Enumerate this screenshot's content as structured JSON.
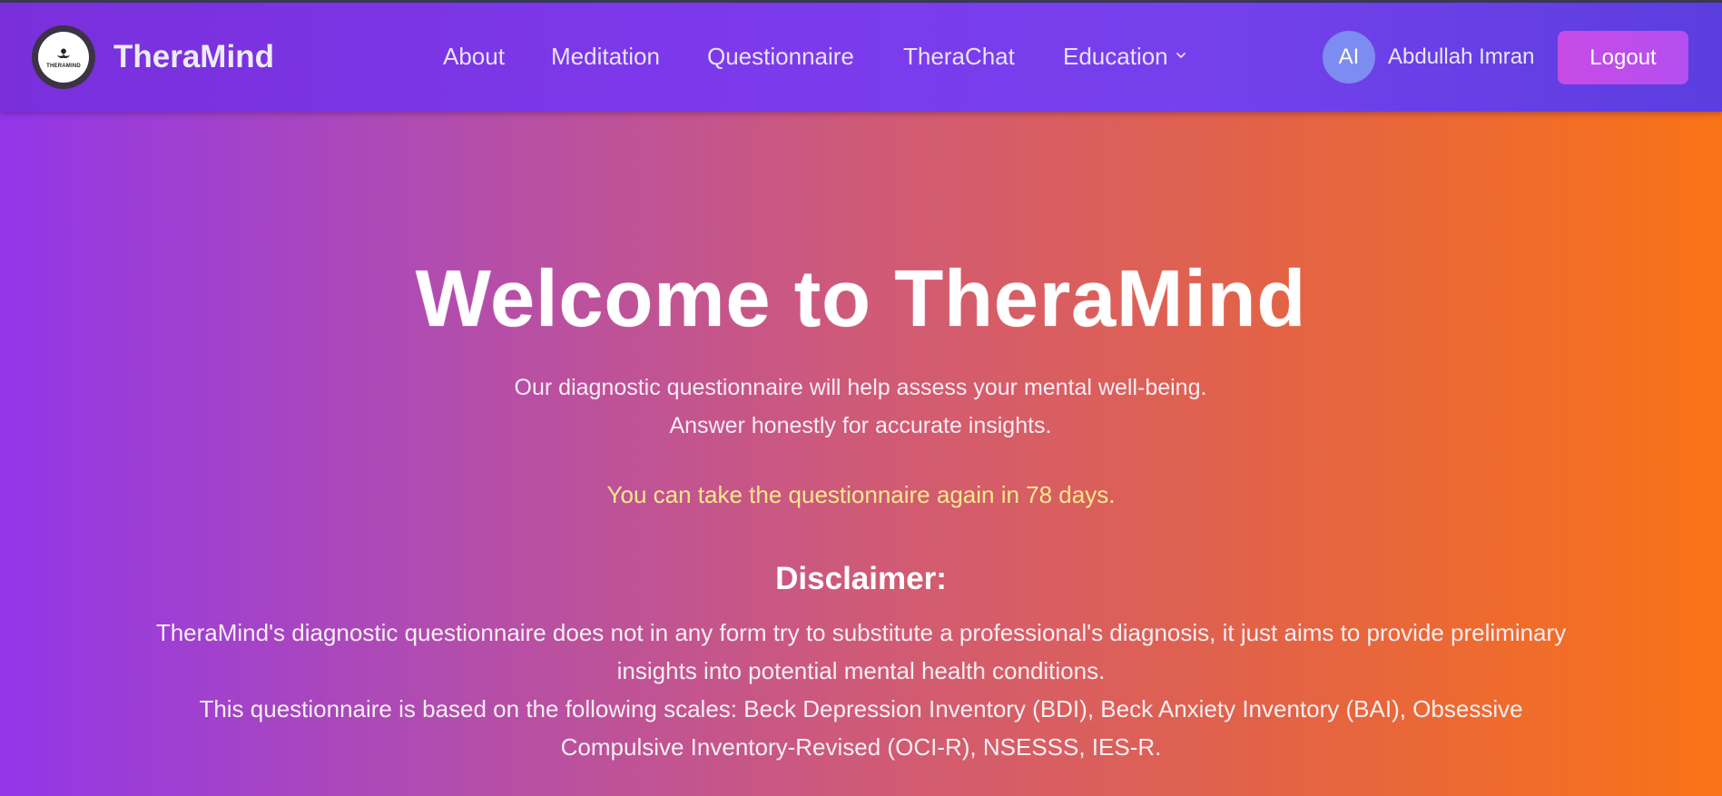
{
  "app": {
    "brand_name": "TheraMind",
    "logo_text": "THERAMIND"
  },
  "nav": {
    "items": [
      {
        "label": "About"
      },
      {
        "label": "Meditation"
      },
      {
        "label": "Questionnaire"
      },
      {
        "label": "TheraChat"
      },
      {
        "label": "Education"
      }
    ]
  },
  "user": {
    "initials": "AI",
    "name": "Abdullah Imran",
    "logout_label": "Logout"
  },
  "hero": {
    "title": "Welcome to TheraMind",
    "intro": "Our diagnostic questionnaire will help assess your mental well-being. Answer honestly for accurate insights.",
    "notice": "You can take the questionnaire again in 78 days."
  },
  "disclaimer": {
    "title": "Disclaimer:",
    "paragraph_1": "TheraMind's diagnostic questionnaire does not in any form try to substitute a professional's diagnosis, it just aims to provide preliminary insights into potential mental health conditions.",
    "paragraph_2": "This questionnaire is based on the following scales: Beck Depression Inventory (BDI), Beck Anxiety Inventory (BAI), Obsessive Compulsive Inventory-Revised (OCI-R), NSESSS, IES-R."
  },
  "colors": {
    "navbar": "#7c3aed",
    "notice_text": "#fbe88a",
    "logout_button": "#c84be6",
    "gradient_start": "#9236e8",
    "gradient_end": "#f97316"
  },
  "icons": {
    "logo": "lotus-hands-icon",
    "education_dropdown": "chevron-down-icon"
  }
}
